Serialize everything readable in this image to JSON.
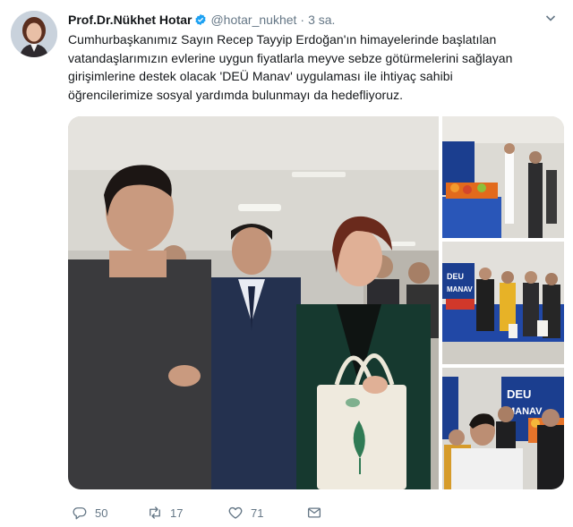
{
  "tweet": {
    "author_name": "Prof.Dr.Nükhet Hotar",
    "verified_icon": "verified-badge-icon",
    "handle": "@hotar_nukhet",
    "separator": "·",
    "time": "3 sa.",
    "text_lines": [
      "Cumhurbaşkanımız Sayın Recep Tayyip Erdoğan'ın himayelerinde başlatılan",
      "vatandaşlarımızın evlerine uygun fiyatlarla meyve sebze götürmelerini sağlayan",
      "girişimlerine destek olacak 'DEÜ Manav' uygulaması ile ihtiyaç sahibi",
      "öğrencilerimize sosyal yardımda bulunmayı da hedefliyoruz."
    ]
  },
  "media": {
    "photo_count": 4,
    "sign_top": "DEU",
    "sign_bottom": "MANAV"
  },
  "actions": {
    "reply_count": "50",
    "retweet_count": "17",
    "like_count": "71"
  },
  "colors": {
    "text": "#14171a",
    "secondary": "#657786",
    "verified": "#1da1f2",
    "sign_blue": "#1b3e8f"
  }
}
